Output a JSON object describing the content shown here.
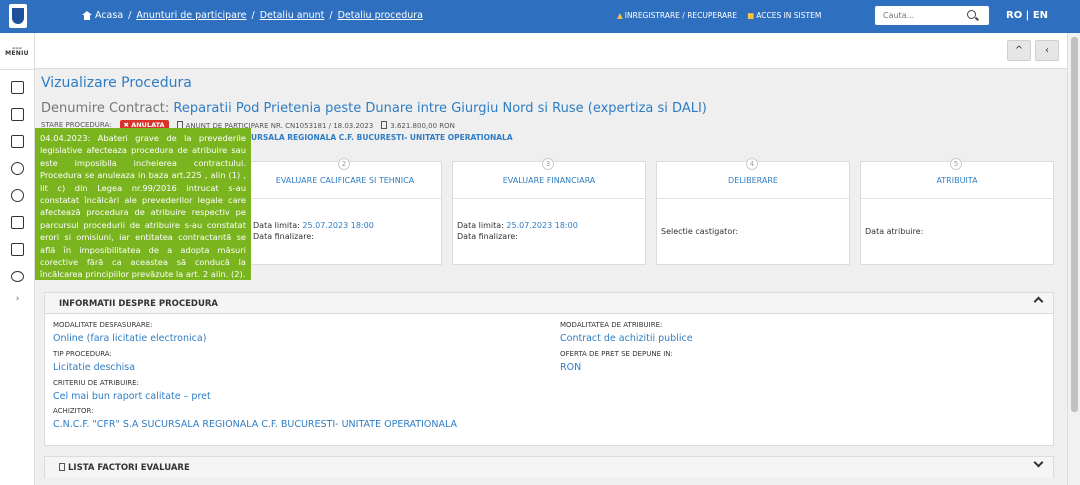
{
  "topbar": {
    "breadcrumb": [
      "Acasa",
      "Anunturi de participare",
      "Detaliu anunt",
      "Detaliu procedura"
    ],
    "register": "INREGISTRARE / RECUPERARE",
    "access": "ACCES IN SISTEM",
    "search_placeholder": "Cauta...",
    "lang": "RO | EN"
  },
  "sidebar": {
    "menu_label": "MENIU",
    "icons": [
      "document-icon",
      "list-icon",
      "book-icon",
      "help-icon",
      "accessibility-icon",
      "id-card-icon",
      "monitor-icon",
      "chat-icon"
    ],
    "expand": "›"
  },
  "subbar": {
    "up": "^",
    "back": "‹"
  },
  "page": {
    "title": "Vizualizare Procedura",
    "contract_label": "Denumire Contract:",
    "contract_name": "Reparatii Pod Prietenia peste Dunare intre Giurgiu Nord si Ruse (expertiza si DALI)",
    "status_label": "STARE PROCEDURA:",
    "status_badge": "✖ ANULATA",
    "notice": "ANUNT DE PARTICIPARE NR. CN1053181 / 18.03.2023",
    "value": "3.621.800,00   RON",
    "authority_partial": "URSALA REGIONALA C.F. BUCURESTI- UNITATE OPERATIONALA"
  },
  "tooltip": "04.04.2023: Abateri grave de la prevederile legislative afecteaza procedura de atribuire sau este imposibila incheierea contractului. Procedura se anuleaza in baza art.225 , alin (1) , lit c) din Legea nr.99/2016 intrucat s-au constatat încălcări ale prevederilor legale care afectează procedura de atribuire respectiv pe parcursul procedurii de atribuire s-au constatat erori si omisiuni, iar entitatea contractantă se află în imposibilitatea de a adopta măsuri corective fără ca aceastea să conducă la încălcarea principiilor prevăzute la art. 2 alin. (2).",
  "steps": [
    {
      "num": "2",
      "title": "EVALUARE CALIFICARE SI TEHNICA",
      "l1": "Data limita:",
      "v1": "25.07.2023 18:00",
      "l2": "Data finalizare:"
    },
    {
      "num": "3",
      "title": "EVALUARE FINANCIARA",
      "l1": "Data limita:",
      "v1": "25.07.2023 18:00",
      "l2": "Data finalizare:"
    },
    {
      "num": "4",
      "title": "DELIBERARE",
      "l1": "Selectie castigator:"
    },
    {
      "num": "5",
      "title": "ATRIBUITA",
      "l1": "Data atribuire:"
    }
  ],
  "info": {
    "header": "INFORMATII DESPRE PROCEDURA",
    "modalitate_label": "MODALITATE DESFASURARE:",
    "modalitate_value": "Online (fara licitatie electronica)",
    "tip_label": "TIP PROCEDURA:",
    "tip_value": "Licitatie deschisa",
    "criteriu_label": "CRITERIU DE ATRIBUIRE:",
    "criteriu_value": "Cel mai bun raport calitate – pret",
    "achizitor_label": "ACHIZITOR:",
    "achizitor_value": "C.N.C.F. \"CFR\" S.A SUCURSALA REGIONALA C.F. BUCURESTI- UNITATE OPERATIONALA",
    "modatrib_label": "MODALITATEA DE ATRIBUIRE:",
    "modatrib_value": "Contract de achizitii publice",
    "oferta_label": "OFERTA DE PRET SE DEPUNE IN:",
    "oferta_value": "RON"
  },
  "factori": {
    "header": "LISTA FACTORI EVALUARE"
  }
}
